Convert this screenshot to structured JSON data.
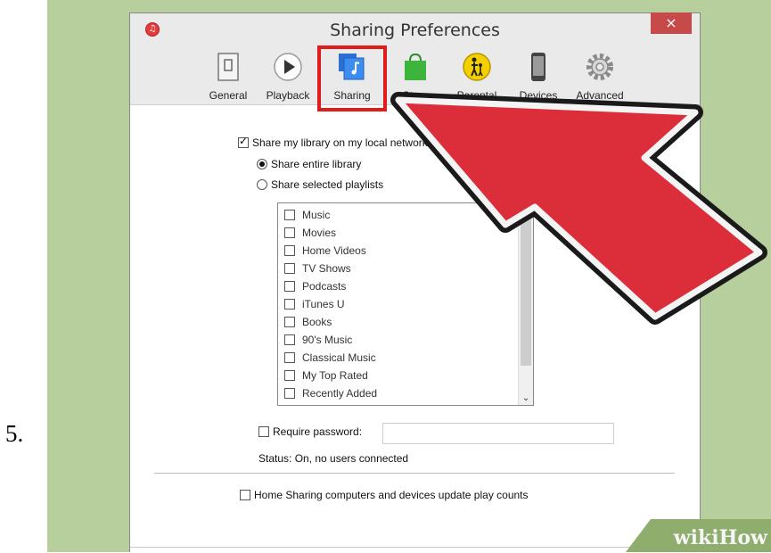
{
  "step": {
    "number": "5."
  },
  "window": {
    "title": "Sharing Preferences",
    "close_glyph": "×",
    "app_icon_glyph": "♫"
  },
  "toolbar": {
    "tabs": [
      {
        "label": "General",
        "icon": "general-icon"
      },
      {
        "label": "Playback",
        "icon": "play-icon"
      },
      {
        "label": "Sharing",
        "icon": "sharing-icon",
        "selected": true
      },
      {
        "label": "Store",
        "icon": "store-bag-icon"
      },
      {
        "label": "Parental",
        "icon": "parental-icon"
      },
      {
        "label": "Devices",
        "icon": "device-icon"
      },
      {
        "label": "Advanced",
        "icon": "gear-icon"
      }
    ]
  },
  "sharing": {
    "share_library_label": "Share my library on my local network",
    "share_library_checked": true,
    "entire_library_label": "Share entire library",
    "entire_library_selected": true,
    "selected_playlists_label": "Share selected playlists",
    "selected_playlists_selected": false,
    "playlists": [
      "Music",
      "Movies",
      "Home Videos",
      "TV Shows",
      "Podcasts",
      "iTunes U",
      "Books",
      "90's Music",
      "Classical Music",
      "My Top Rated",
      "Recently Added"
    ],
    "scroll_down_glyph": "⌄",
    "require_password_label": "Require password:",
    "require_password_checked": false,
    "password_value": "",
    "status_text": "Status: On, no users connected",
    "home_sharing_label": "Home Sharing computers and devices update play counts",
    "home_sharing_checked": false
  },
  "watermark": {
    "text": "wikiHow"
  },
  "colors": {
    "highlight": "#e01b1b",
    "arrow": "#dc2d3a",
    "background": "#b7cf9c"
  }
}
